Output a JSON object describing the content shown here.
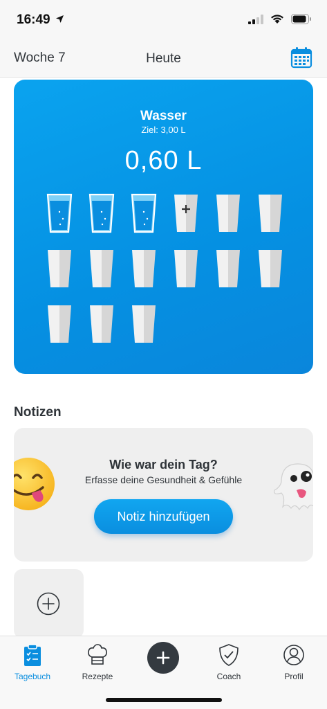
{
  "status": {
    "time": "16:49"
  },
  "header": {
    "week": "Woche 7",
    "title": "Heute"
  },
  "water": {
    "title": "Wasser",
    "goal": "Ziel: 3,00 L",
    "amount": "0,60 L",
    "glasses_total": 15,
    "glasses_filled": 3,
    "accent": "#0a96e6"
  },
  "notes": {
    "section_title": "Notizen",
    "heading": "Wie war dein Tag?",
    "subtitle": "Erfasse deine Gesundheit & Gefühle",
    "button_label": "Notiz hinzufügen"
  },
  "tabbar": {
    "items": [
      {
        "label": "Tagebuch",
        "icon": "clipboard-check-icon",
        "active": true
      },
      {
        "label": "Rezepte",
        "icon": "chef-hat-icon",
        "active": false
      },
      {
        "label": "",
        "icon": "plus-icon",
        "active": false
      },
      {
        "label": "Coach",
        "icon": "shield-check-icon",
        "active": false
      },
      {
        "label": "Profil",
        "icon": "user-circle-icon",
        "active": false
      }
    ]
  },
  "colors": {
    "accent": "#0a8edf",
    "dark": "#343a40",
    "text": "#2e3338"
  }
}
